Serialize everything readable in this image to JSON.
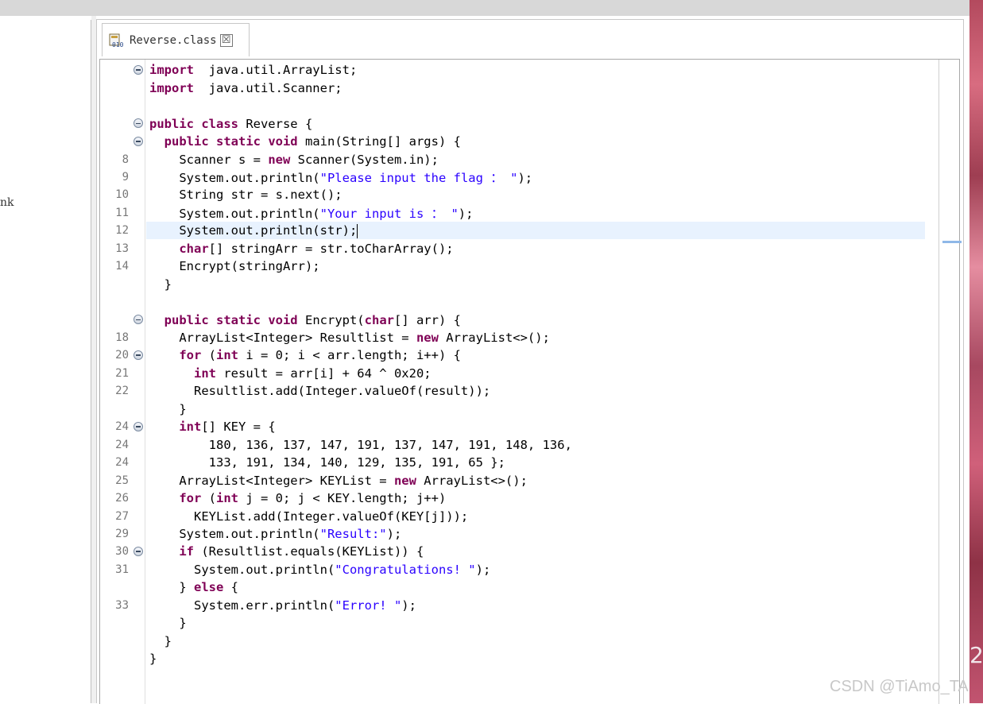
{
  "tab": {
    "title": "Reverse.class",
    "close_glyph": "☒",
    "icon": "class-file-icon"
  },
  "left_panel": {
    "fragment": "nk"
  },
  "right_strip": {
    "fragment": "2"
  },
  "watermark": "CSDN @TiAmo_TA",
  "editor": {
    "highlighted_line": 9,
    "lines": [
      {
        "num": "",
        "fold": true,
        "segments": [
          [
            "kw",
            "import"
          ],
          [
            "",
            "  java.util.ArrayList;"
          ]
        ]
      },
      {
        "num": "",
        "fold": false,
        "segments": [
          [
            "kw",
            "import"
          ],
          [
            "",
            "  java.util.Scanner;"
          ]
        ]
      },
      {
        "num": "",
        "fold": false,
        "segments": []
      },
      {
        "num": "",
        "fold": true,
        "segments": [
          [
            "kw",
            "public class"
          ],
          [
            "",
            " Reverse {"
          ]
        ]
      },
      {
        "num": "",
        "fold": true,
        "segments": [
          [
            "",
            "  "
          ],
          [
            "kw",
            "public static void"
          ],
          [
            "",
            " main(String[] args) {"
          ]
        ]
      },
      {
        "num": "8",
        "fold": false,
        "segments": [
          [
            "",
            "    Scanner s = "
          ],
          [
            "kw",
            "new"
          ],
          [
            "",
            " Scanner(System.in);"
          ]
        ]
      },
      {
        "num": "9",
        "fold": false,
        "segments": [
          [
            "",
            "    System.out.println("
          ],
          [
            "str",
            "\"Please input the flag ： \""
          ],
          [
            "",
            ");"
          ]
        ]
      },
      {
        "num": "10",
        "fold": false,
        "segments": [
          [
            "",
            "    String str = s.next();"
          ]
        ]
      },
      {
        "num": "11",
        "fold": false,
        "segments": [
          [
            "",
            "    System.out.println("
          ],
          [
            "str",
            "\"Your input is ： \""
          ],
          [
            "",
            ");"
          ]
        ]
      },
      {
        "num": "12",
        "fold": false,
        "segments": [
          [
            "",
            "    System.out.println(str);"
          ]
        ],
        "caret": true
      },
      {
        "num": "13",
        "fold": false,
        "segments": [
          [
            "",
            "    "
          ],
          [
            "kw",
            "char"
          ],
          [
            "",
            "[] stringArr = str.toCharArray();"
          ]
        ]
      },
      {
        "num": "14",
        "fold": false,
        "segments": [
          [
            "",
            "    Encrypt(stringArr);"
          ]
        ]
      },
      {
        "num": "",
        "fold": false,
        "segments": [
          [
            "",
            "  }"
          ]
        ]
      },
      {
        "num": "",
        "fold": false,
        "segments": []
      },
      {
        "num": "",
        "fold": true,
        "segments": [
          [
            "",
            "  "
          ],
          [
            "kw",
            "public static void"
          ],
          [
            "",
            " Encrypt("
          ],
          [
            "kw",
            "char"
          ],
          [
            "",
            "[] arr) {"
          ]
        ]
      },
      {
        "num": "18",
        "fold": false,
        "segments": [
          [
            "",
            "    ArrayList<Integer> Resultlist = "
          ],
          [
            "kw",
            "new"
          ],
          [
            "",
            " ArrayList<>();"
          ]
        ]
      },
      {
        "num": "20",
        "fold": true,
        "segments": [
          [
            "",
            "    "
          ],
          [
            "kw",
            "for"
          ],
          [
            "",
            " ("
          ],
          [
            "kw",
            "int"
          ],
          [
            "",
            " i = 0; i < arr.length; i++) {"
          ]
        ]
      },
      {
        "num": "21",
        "fold": false,
        "segments": [
          [
            "",
            "      "
          ],
          [
            "kw",
            "int"
          ],
          [
            "",
            " result = arr[i] + 64 ^ 0x20;"
          ]
        ]
      },
      {
        "num": "22",
        "fold": false,
        "segments": [
          [
            "",
            "      Resultlist.add(Integer.valueOf(result));"
          ]
        ]
      },
      {
        "num": "",
        "fold": false,
        "segments": [
          [
            "",
            "    }"
          ]
        ]
      },
      {
        "num": "24",
        "fold": true,
        "segments": [
          [
            "",
            "    "
          ],
          [
            "kw",
            "int"
          ],
          [
            "",
            "[] KEY = {"
          ]
        ]
      },
      {
        "num": "24",
        "fold": false,
        "segments": [
          [
            "",
            "        180, 136, 137, 147, 191, 137, 147, 191, 148, 136,"
          ]
        ]
      },
      {
        "num": "24",
        "fold": false,
        "segments": [
          [
            "",
            "        133, 191, 134, 140, 129, 135, 191, 65 };"
          ]
        ]
      },
      {
        "num": "25",
        "fold": false,
        "segments": [
          [
            "",
            "    ArrayList<Integer> KEYList = "
          ],
          [
            "kw",
            "new"
          ],
          [
            "",
            " ArrayList<>();"
          ]
        ]
      },
      {
        "num": "26",
        "fold": false,
        "segments": [
          [
            "",
            "    "
          ],
          [
            "kw",
            "for"
          ],
          [
            "",
            " ("
          ],
          [
            "kw",
            "int"
          ],
          [
            "",
            " j = 0; j < KEY.length; j++)"
          ]
        ]
      },
      {
        "num": "27",
        "fold": false,
        "segments": [
          [
            "",
            "      KEYList.add(Integer.valueOf(KEY[j]));"
          ]
        ]
      },
      {
        "num": "29",
        "fold": false,
        "segments": [
          [
            "",
            "    System.out.println("
          ],
          [
            "str",
            "\"Result:\""
          ],
          [
            "",
            ");"
          ]
        ]
      },
      {
        "num": "30",
        "fold": true,
        "segments": [
          [
            "",
            "    "
          ],
          [
            "kw",
            "if"
          ],
          [
            "",
            " (Resultlist.equals(KEYList)) {"
          ]
        ]
      },
      {
        "num": "31",
        "fold": false,
        "segments": [
          [
            "",
            "      System.out.println("
          ],
          [
            "str",
            "\"Congratulations! \""
          ],
          [
            "",
            ");"
          ]
        ]
      },
      {
        "num": "",
        "fold": false,
        "segments": [
          [
            "",
            "    } "
          ],
          [
            "kw",
            "else"
          ],
          [
            "",
            " {"
          ]
        ]
      },
      {
        "num": "33",
        "fold": false,
        "segments": [
          [
            "",
            "      System.err.println("
          ],
          [
            "str",
            "\"Error! \""
          ],
          [
            "",
            ");"
          ]
        ]
      },
      {
        "num": "",
        "fold": false,
        "segments": [
          [
            "",
            "    }"
          ]
        ]
      },
      {
        "num": "",
        "fold": false,
        "segments": [
          [
            "",
            "  }"
          ]
        ]
      },
      {
        "num": "",
        "fold": false,
        "segments": [
          [
            "",
            "}"
          ]
        ]
      }
    ]
  }
}
